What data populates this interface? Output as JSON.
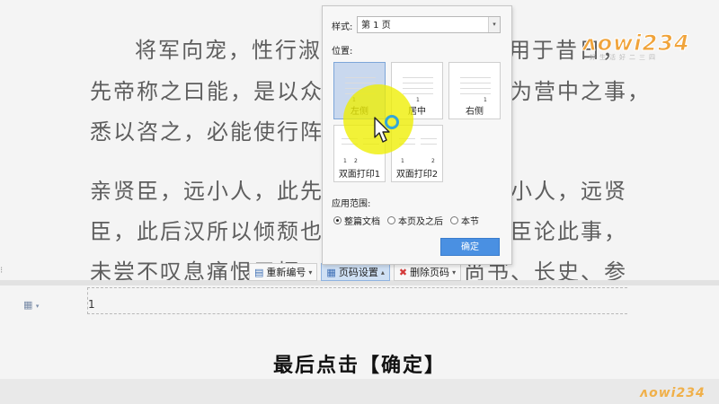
{
  "document": {
    "lines": [
      "将军向宠，性行淑均，晓畅军事，试用于昔日，",
      "先帝称之曰能，是以众议举宠为督。愚以为营中之事，",
      "悉以咨之，必能使行阵和睦，优劣得所。",
      "亲贤臣，远小人，此先汉所以兴隆也；亲小人，远贤",
      "臣，此后汉所以倾颓也。先帝在时，每与臣论此事，",
      "未尝不叹息痛恨于桓、灵也。侍中、尚书、长史、参"
    ],
    "footer_page_number": "1"
  },
  "toolbar": {
    "renumber_label": "重新编号",
    "page_settings_label": "页码设置",
    "delete_label": "删除页码"
  },
  "dialog": {
    "style_label": "样式:",
    "style_value": "第 1 页",
    "position_label": "位置:",
    "positions": [
      {
        "label": "左侧",
        "selected": true
      },
      {
        "label": "居中",
        "selected": false
      },
      {
        "label": "右侧",
        "selected": false
      },
      {
        "label": "双面打印1",
        "selected": false
      },
      {
        "label": "双面打印2",
        "selected": false
      }
    ],
    "scope_label": "应用范围:",
    "scope_options": [
      {
        "label": "整篇文档",
        "checked": true
      },
      {
        "label": "本页及之后",
        "checked": false
      },
      {
        "label": "本节",
        "checked": false
      }
    ],
    "ok_label": "确定"
  },
  "logo": {
    "main": "ʌowi234",
    "sub": "好生活好二三四",
    "small": "ʌowi234"
  },
  "caption": "最后点击【确定】",
  "page_num_glyphs": {
    "one": "1",
    "two": "2"
  },
  "icons": {
    "renumber": "renumber-icon",
    "page_settings": "page-settings-icon",
    "delete": "delete-icon",
    "footer_marker": "footer-marker-icon"
  },
  "colors": {
    "accent": "#4a90e2",
    "highlight": "#eeee00",
    "logo": "#f0a33a"
  }
}
